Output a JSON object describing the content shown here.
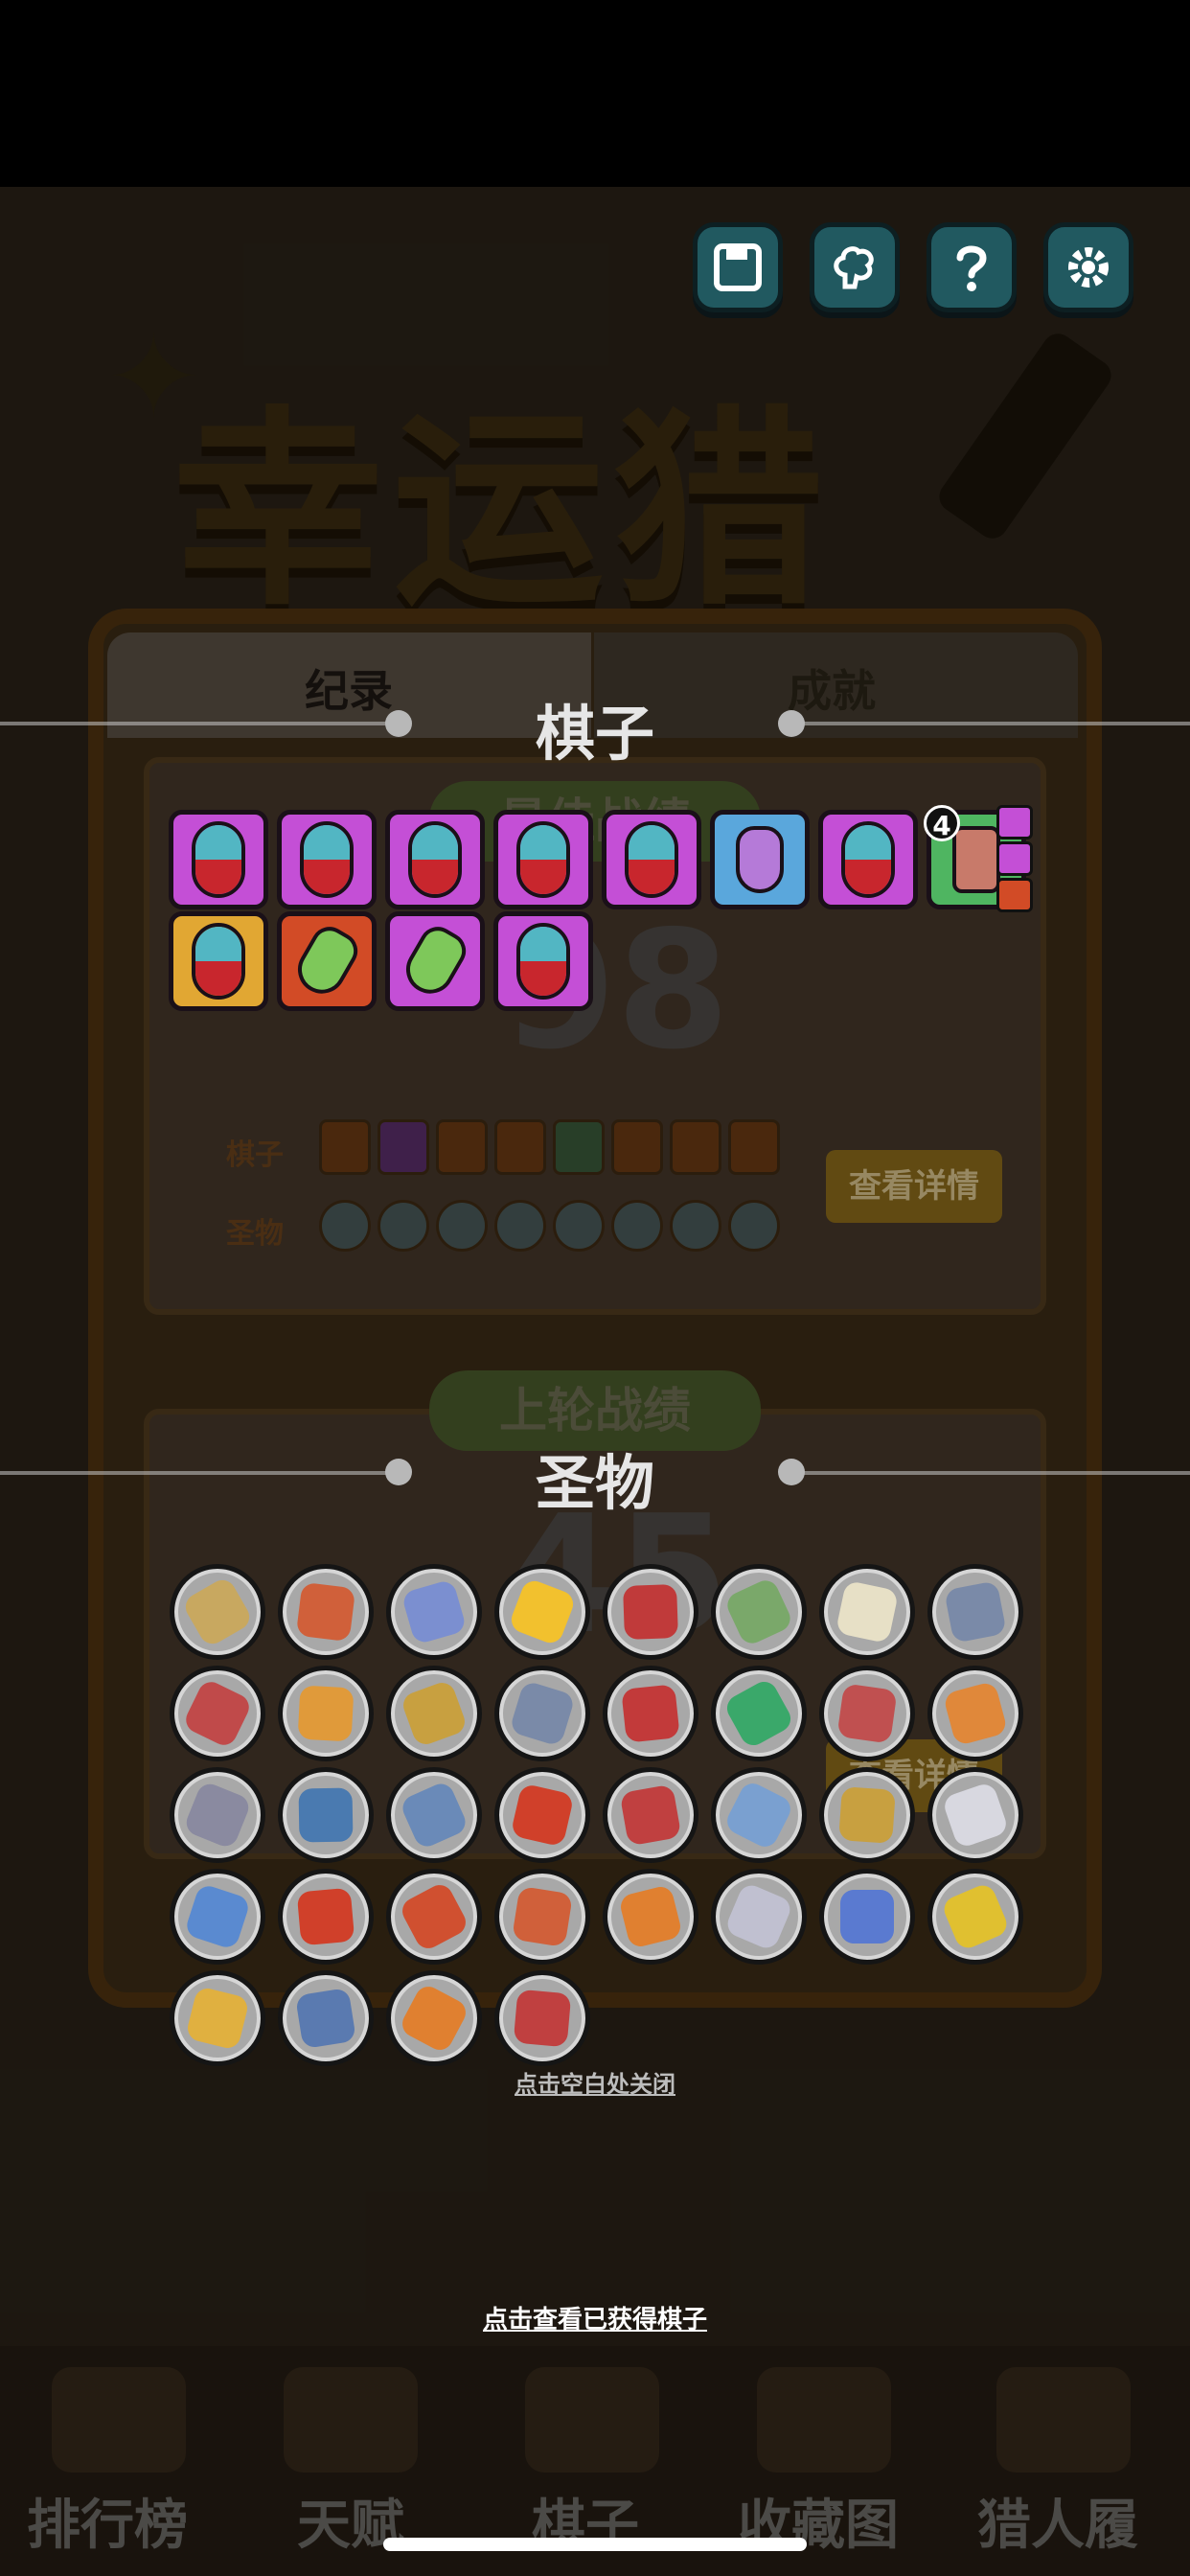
{
  "background": {
    "logo_text": "幸运猎人",
    "tabs": [
      "纪录",
      "成就"
    ],
    "best_record": {
      "title": "最佳战绩",
      "value": "98"
    },
    "last_record": {
      "title": "上轮战绩",
      "value": "45"
    },
    "row_labels": {
      "pieces": "棋子",
      "relics": "圣物"
    },
    "details_button": "查看详情",
    "bottom_nav": [
      "排行榜",
      "天赋",
      "棋子",
      "收藏图",
      "猎人履"
    ]
  },
  "overlay": {
    "pieces_title": "棋子",
    "relics_title": "圣物",
    "close_hint": "点击空白处关闭",
    "view_pieces_hint": "点击查看已获得棋子",
    "top_buttons": [
      "save-icon",
      "brain-icon",
      "help-icon",
      "settings-icon"
    ],
    "pieces": [
      {
        "kind": "pill",
        "frame": "purple"
      },
      {
        "kind": "pill",
        "frame": "purple"
      },
      {
        "kind": "pill",
        "frame": "purple"
      },
      {
        "kind": "pill",
        "frame": "purple"
      },
      {
        "kind": "pill",
        "frame": "purple"
      },
      {
        "kind": "potion",
        "frame": "blue"
      },
      {
        "kind": "pill",
        "frame": "purple"
      },
      {
        "kind": "chest",
        "frame": "green",
        "count": "4"
      },
      {
        "kind": "pill",
        "frame": "gold"
      },
      {
        "kind": "battery",
        "frame": "orange"
      },
      {
        "kind": "battery",
        "frame": "purple"
      },
      {
        "kind": "pill",
        "frame": "purple"
      }
    ],
    "relic_colors": [
      "#c8a860",
      "#d0603a",
      "#7b8fd0",
      "#f2c12e",
      "#c03a3a",
      "#7aa86a",
      "#e7e0c6",
      "#7a8aa8",
      "#c04a4a",
      "#e09a3a",
      "#c8a040",
      "#7a8aa8",
      "#c23a3a",
      "#3aa86a",
      "#c05050",
      "#e0883a",
      "#8a8aa0",
      "#4a7ab0",
      "#6a8ab8",
      "#d0402a",
      "#c04040",
      "#7aa0d0",
      "#c8a040",
      "#d8d8e0",
      "#5a8ad0",
      "#d0402a",
      "#d05030",
      "#d0603a",
      "#e08030",
      "#c0c0d0",
      "#5a7ad0",
      "#e0c030",
      "#e0b040",
      "#5a7ab0",
      "#e08030",
      "#c04040"
    ]
  }
}
